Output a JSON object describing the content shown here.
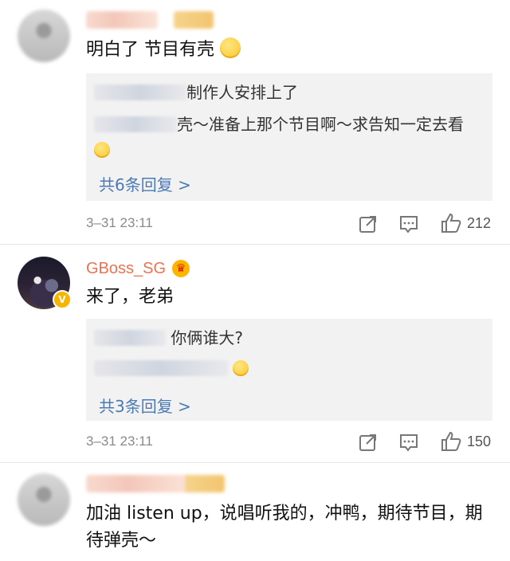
{
  "comments": [
    {
      "text": "明白了 节目有壳",
      "replies": [
        {
          "text": "制作人安排上了"
        },
        {
          "text": "壳～准备上那个节目啊～求告知一定去看"
        }
      ],
      "reply_count": "共6条回复 >",
      "timestamp": "3–31 23:11",
      "likes": "212"
    },
    {
      "username": "GBoss_SG",
      "text": "来了，老弟",
      "replies": [
        {
          "text": "你俩谁大?"
        },
        {
          "text": ""
        }
      ],
      "reply_count": "共3条回复 >",
      "timestamp": "3–31 23:11",
      "likes": "150"
    },
    {
      "text": "加油 listen up，说唱听我的，冲鸭，期待节目，期待弹壳～"
    }
  ],
  "colors": {
    "username": "#eb7350",
    "reply_count": "#4a7bb4",
    "reply_bg": "#f2f2f2",
    "meta": "#8a8a8a"
  }
}
